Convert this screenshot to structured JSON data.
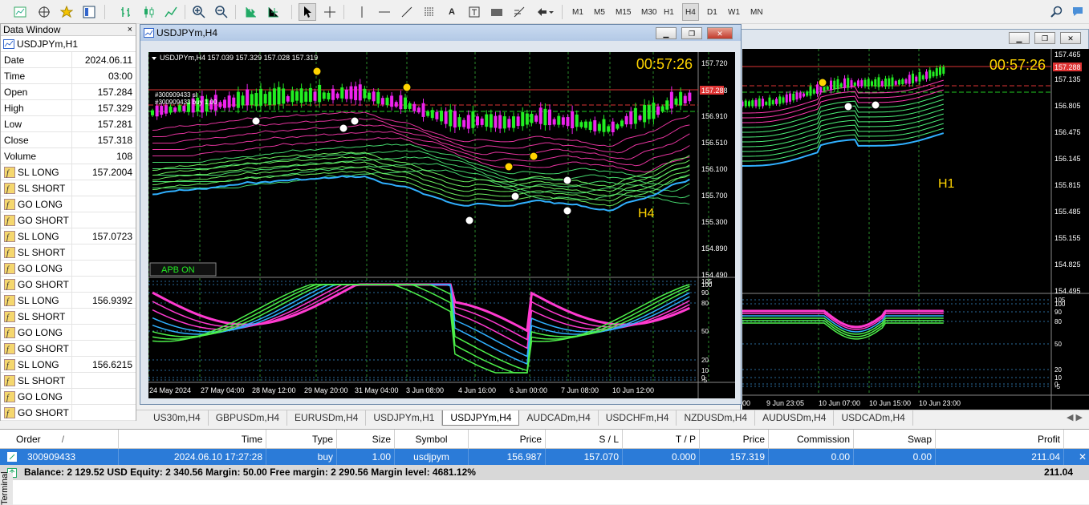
{
  "toolbar": {
    "timeframes": [
      "M1",
      "M5",
      "M15",
      "M30",
      "H1",
      "H4",
      "D1",
      "W1",
      "MN"
    ],
    "active_timeframe": "H4"
  },
  "data_window": {
    "title": "Data Window",
    "close": "×",
    "symbol": "USDJPYm,H1",
    "rows": [
      {
        "k": "Date",
        "v": "2024.06.11"
      },
      {
        "k": "Time",
        "v": "03:00"
      },
      {
        "k": "Open",
        "v": "157.284"
      },
      {
        "k": "High",
        "v": "157.329"
      },
      {
        "k": "Low",
        "v": "157.281"
      },
      {
        "k": "Close",
        "v": "157.318"
      },
      {
        "k": "Volume",
        "v": "108"
      },
      {
        "k": "SL LONG",
        "v": "157.2004",
        "i": 1
      },
      {
        "k": "SL SHORT",
        "v": "",
        "i": 1
      },
      {
        "k": "GO LONG",
        "v": "",
        "i": 1
      },
      {
        "k": "GO SHORT",
        "v": "",
        "i": 1
      },
      {
        "k": "SL LONG",
        "v": "157.0723",
        "i": 1
      },
      {
        "k": "SL SHORT",
        "v": "",
        "i": 1
      },
      {
        "k": "GO LONG",
        "v": "",
        "i": 1
      },
      {
        "k": "GO SHORT",
        "v": "",
        "i": 1
      },
      {
        "k": "SL LONG",
        "v": "156.9392",
        "i": 1
      },
      {
        "k": "SL SHORT",
        "v": "",
        "i": 1
      },
      {
        "k": "GO LONG",
        "v": "",
        "i": 1
      },
      {
        "k": "GO SHORT",
        "v": "",
        "i": 1
      },
      {
        "k": "SL LONG",
        "v": "156.6215",
        "i": 1
      },
      {
        "k": "SL SHORT",
        "v": "",
        "i": 1
      },
      {
        "k": "GO LONG",
        "v": "",
        "i": 1
      },
      {
        "k": "GO SHORT",
        "v": "",
        "i": 1
      }
    ]
  },
  "win_h4": {
    "title": "USDJPYm,H4",
    "header": "USDJPYm,H4  157.039 157.329 157.028 157.319",
    "timer": "00:57:26",
    "label": "H4",
    "apb": "APB ON",
    "order_line1": "#300909433 sl",
    "order_line2": "#300909433 buy 1.00",
    "prices": [
      "157.720",
      "157.288",
      "156.910",
      "156.510",
      "156.100",
      "155.700",
      "155.300",
      "154.890",
      "154.490"
    ],
    "osc": [
      "105",
      "100",
      "90",
      "80",
      "50",
      "20",
      "10",
      "0",
      "-5"
    ],
    "dates": [
      "24 May 2024",
      "27 May 04:00",
      "28 May 12:00",
      "29 May 20:00",
      "31 May 04:00",
      "3 Jun 08:00",
      "4 Jun 16:00",
      "6 Jun 00:00",
      "7 Jun 08:00",
      "10 Jun 12:00"
    ]
  },
  "win_h1": {
    "timer": "00:57:26",
    "label": "H1",
    "prices": [
      "157.465",
      "157.288",
      "157.135",
      "156.805",
      "156.475",
      "156.145",
      "155.815",
      "155.485",
      "155.155",
      "154.825",
      "154.495"
    ],
    "osc": [
      "105",
      "100",
      "90",
      "80",
      "50",
      "20",
      "10",
      "0",
      "-5"
    ],
    "dates": [
      "00",
      "9 Jun 23:05",
      "10 Jun 07:00",
      "10 Jun 15:00",
      "10 Jun 23:00"
    ]
  },
  "tabs": [
    "US30m,H4",
    "GBPUSDm,H4",
    "EURUSDm,H4",
    "USDJPYm,H1",
    "USDJPYm,H4",
    "AUDCADm,H4",
    "USDCHFm,H4",
    "NZDUSDm,H4",
    "AUDUSDm,H4",
    "USDCADm,H4"
  ],
  "active_tab": "USDJPYm,H4",
  "terminal": {
    "headers": [
      "Order",
      "Time",
      "Type",
      "Size",
      "Symbol",
      "Price",
      "S / L",
      "T / P",
      "Price",
      "Commission",
      "Swap",
      "Profit"
    ],
    "order_sort": "/",
    "row": [
      "300909433",
      "2024.06.10 17:27:28",
      "buy",
      "1.00",
      "usdjpym",
      "156.987",
      "157.070",
      "0.000",
      "157.319",
      "0.00",
      "0.00",
      "211.04"
    ],
    "balance": "Balance: 2 129.52 USD  Equity: 2 340.56  Margin: 50.00  Free margin: 2 290.56  Margin level: 4681.12%",
    "total": "211.04",
    "side": "Terminal"
  }
}
